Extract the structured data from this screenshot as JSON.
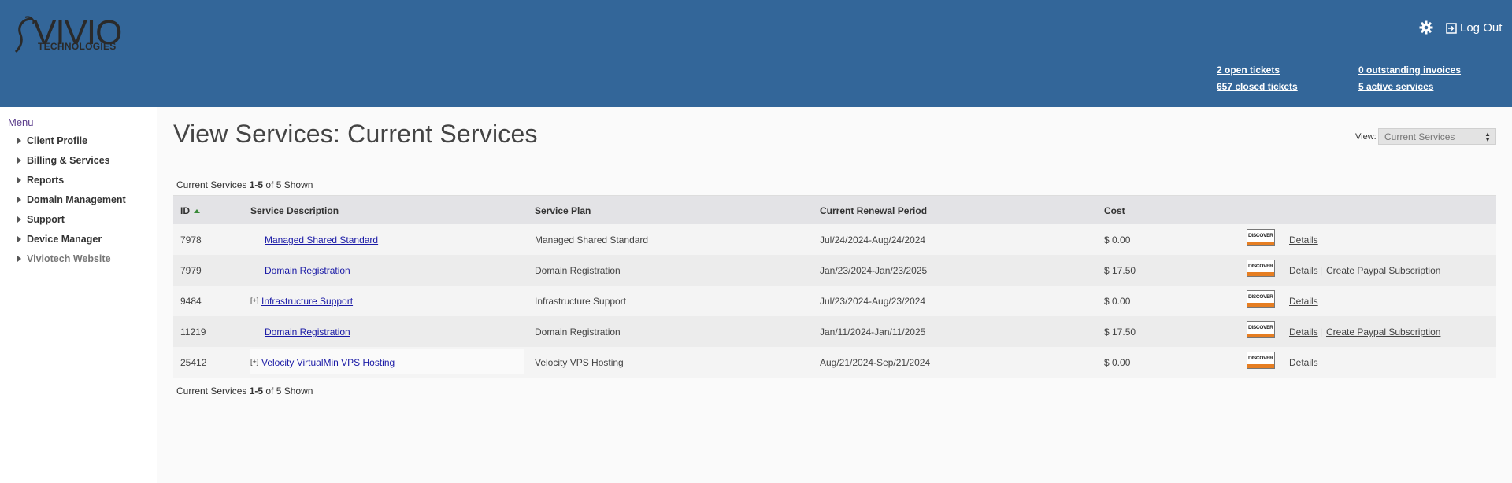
{
  "brand": {
    "name": "VIVIO",
    "sub": "TECHNOLOGIES"
  },
  "header": {
    "logout_label": "Log Out",
    "stats": {
      "open_tickets": "2 open tickets",
      "closed_tickets": "657 closed tickets",
      "outstanding_invoices": "0 outstanding invoices",
      "active_services": "5 active services"
    }
  },
  "sidebar": {
    "menu_title": "Menu",
    "items": [
      {
        "label": "Client Profile"
      },
      {
        "label": "Billing & Services"
      },
      {
        "label": "Reports"
      },
      {
        "label": "Domain Management"
      },
      {
        "label": "Support"
      },
      {
        "label": "Device Manager"
      },
      {
        "label": "Viviotech Website"
      }
    ]
  },
  "main": {
    "title": "View Services: Current Services",
    "view_label": "View:",
    "view_selected": "Current Services",
    "count": {
      "prefix": "Current Services ",
      "range": "1-5",
      "of": " of ",
      "total": "5",
      "suffix": " Shown"
    },
    "columns": {
      "id": "ID",
      "description": "Service Description",
      "plan": "Service Plan",
      "renewal": "Current Renewal Period",
      "cost": "Cost"
    },
    "rows": [
      {
        "id": "7978",
        "expand": "",
        "description": "Managed Shared Standard",
        "plan": "Managed Shared Standard",
        "renewal": "Jul/24/2024-Aug/24/2024",
        "cost": "$ 0.00",
        "card": "DISCOVER",
        "details": "Details",
        "sep": "",
        "paypal": ""
      },
      {
        "id": "7979",
        "expand": "",
        "description": "Domain Registration",
        "plan": "Domain Registration",
        "renewal": "Jan/23/2024-Jan/23/2025",
        "cost": "$ 17.50",
        "card": "DISCOVER",
        "details": "Details",
        "sep": "|",
        "paypal": "Create Paypal Subscription"
      },
      {
        "id": "9484",
        "expand": "[+]",
        "description": "Infrastructure Support",
        "plan": "Infrastructure Support",
        "renewal": "Jul/23/2024-Aug/23/2024",
        "cost": "$ 0.00",
        "card": "DISCOVER",
        "details": "Details",
        "sep": "",
        "paypal": ""
      },
      {
        "id": "11219",
        "expand": "",
        "description": "Domain Registration",
        "plan": "Domain Registration",
        "renewal": "Jan/11/2024-Jan/11/2025",
        "cost": "$ 17.50",
        "card": "DISCOVER",
        "details": "Details",
        "sep": "|",
        "paypal": "Create Paypal Subscription"
      },
      {
        "id": "25412",
        "expand": "[+]",
        "description": "Velocity VirtualMin VPS Hosting",
        "plan": "Velocity VPS Hosting",
        "renewal": "Aug/21/2024-Sep/21/2024",
        "cost": "$ 0.00",
        "card": "DISCOVER",
        "details": "Details",
        "sep": "",
        "paypal": ""
      }
    ]
  }
}
